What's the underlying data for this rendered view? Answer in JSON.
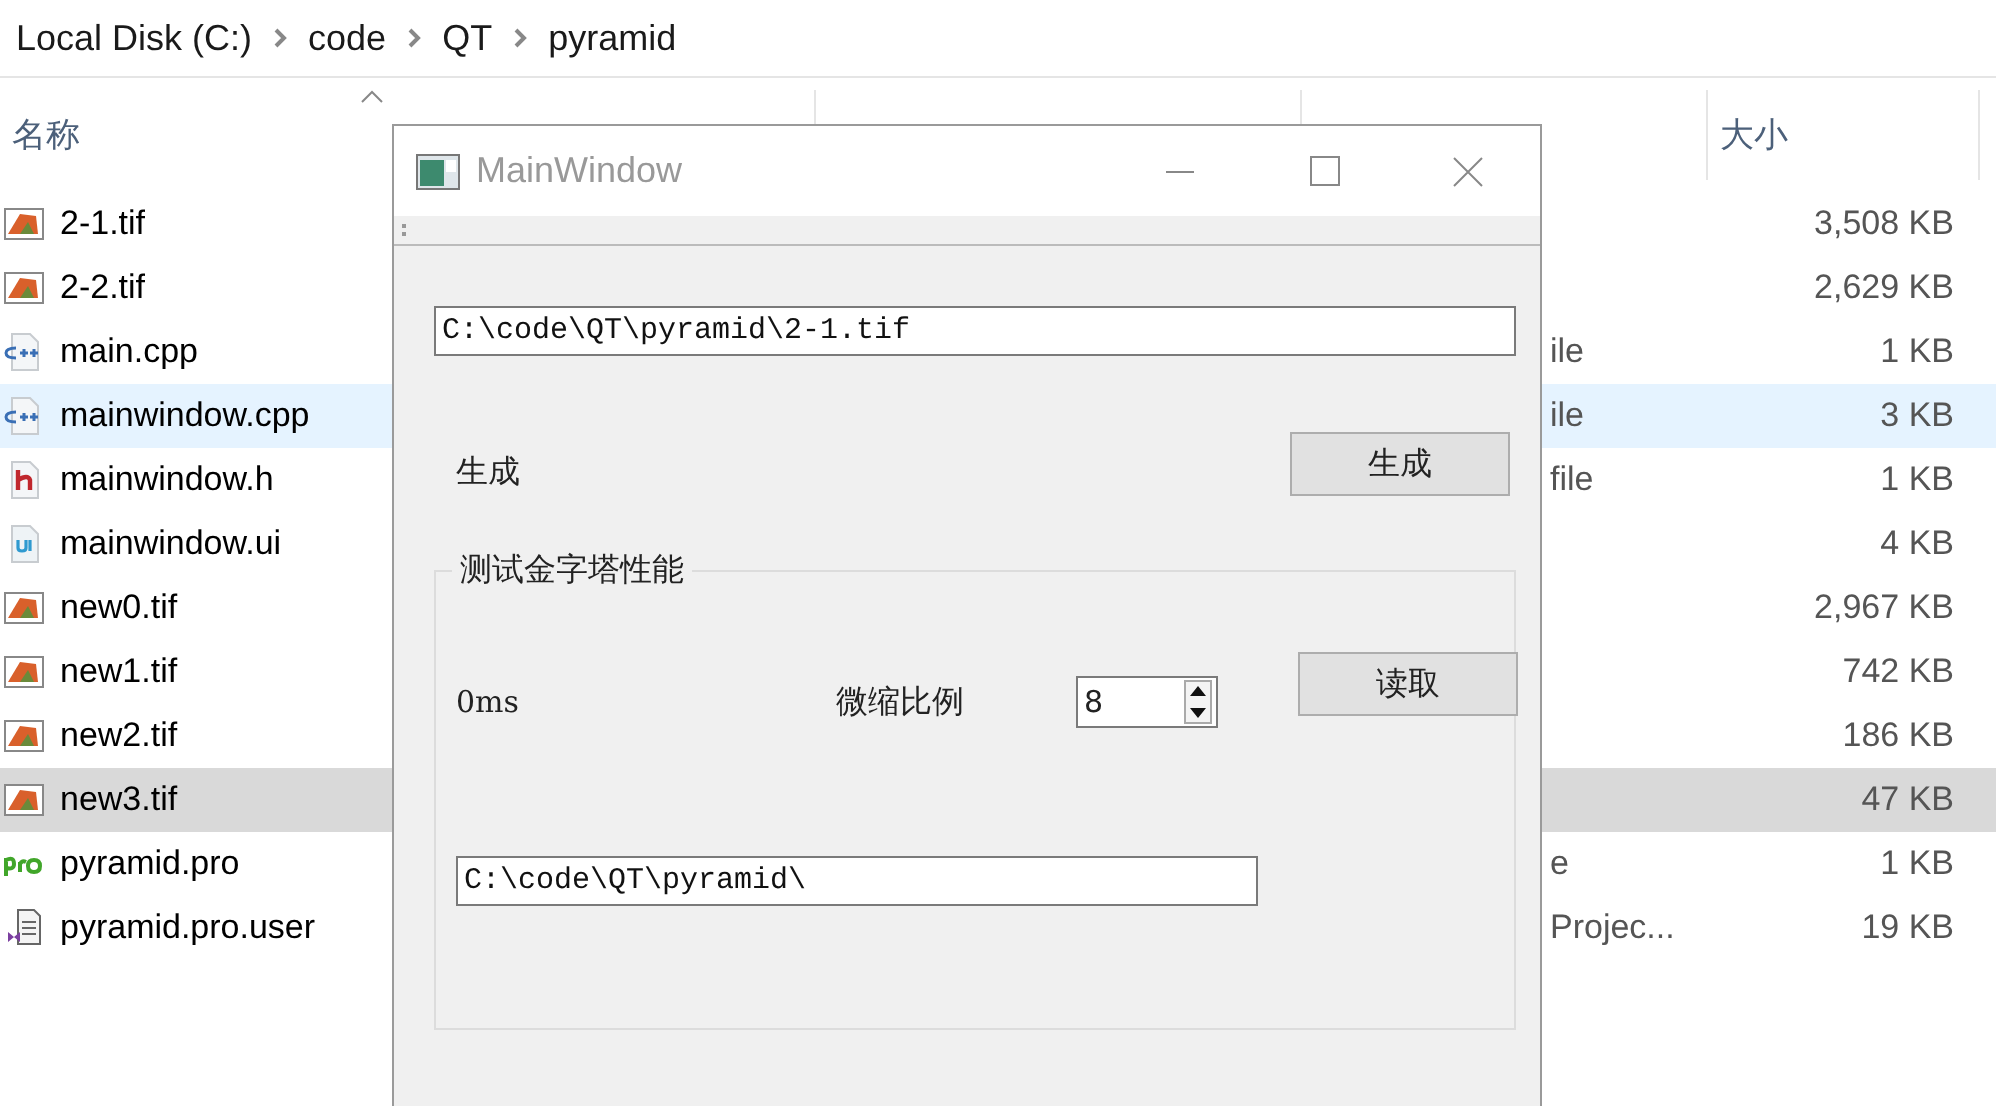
{
  "breadcrumb": [
    "Local Disk (C:)",
    "code",
    "QT",
    "pyramid"
  ],
  "columns": [
    {
      "label": "名称",
      "sorted": true
    },
    {
      "label": "大小",
      "sorted": false
    }
  ],
  "files": [
    {
      "name": "2-1.tif",
      "kind": "image",
      "size": "3,508 KB",
      "selected": false,
      "hovered": false
    },
    {
      "name": "2-2.tif",
      "kind": "image",
      "size": "2,629 KB",
      "selected": false,
      "hovered": false
    },
    {
      "name": "main.cpp",
      "kind": "cpp",
      "column_3": "ile",
      "size": "1 KB",
      "selected": false,
      "hovered": false
    },
    {
      "name": "mainwindow.cpp",
      "kind": "cpp",
      "column_3": "ile",
      "size": "3 KB",
      "selected": false,
      "hovered": true
    },
    {
      "name": "mainwindow.h",
      "kind": "header",
      "column_3": "file",
      "size": "1 KB",
      "selected": false,
      "hovered": false
    },
    {
      "name": "mainwindow.ui",
      "kind": "ui",
      "size": "4 KB",
      "selected": false,
      "hovered": false
    },
    {
      "name": "new0.tif",
      "kind": "image",
      "size": "2,967 KB",
      "selected": false,
      "hovered": false
    },
    {
      "name": "new1.tif",
      "kind": "image",
      "size": "742 KB",
      "selected": false,
      "hovered": false
    },
    {
      "name": "new2.tif",
      "kind": "image",
      "size": "186 KB",
      "selected": false,
      "hovered": false
    },
    {
      "name": "new3.tif",
      "kind": "image",
      "size": "47 KB",
      "selected": true,
      "hovered": false
    },
    {
      "name": "pyramid.pro",
      "kind": "pro",
      "column_3": "e",
      "size": "1 KB",
      "selected": false,
      "hovered": false
    },
    {
      "name": "pyramid.pro.user",
      "kind": "user",
      "column_3": "Projec...",
      "size": "19 KB",
      "selected": false,
      "hovered": false
    }
  ],
  "dialog": {
    "title": "MainWindow",
    "image_path": "C:\\code\\QT\\pyramid\\2-1.tif",
    "generate_label": "生成",
    "generate_button": "生成",
    "group_title": "测试金字塔性能",
    "time": "0ms",
    "scale_label": "微缩比例",
    "scale_value": "8",
    "read_button": "读取",
    "output_path": "C:\\code\\QT\\pyramid\\"
  }
}
